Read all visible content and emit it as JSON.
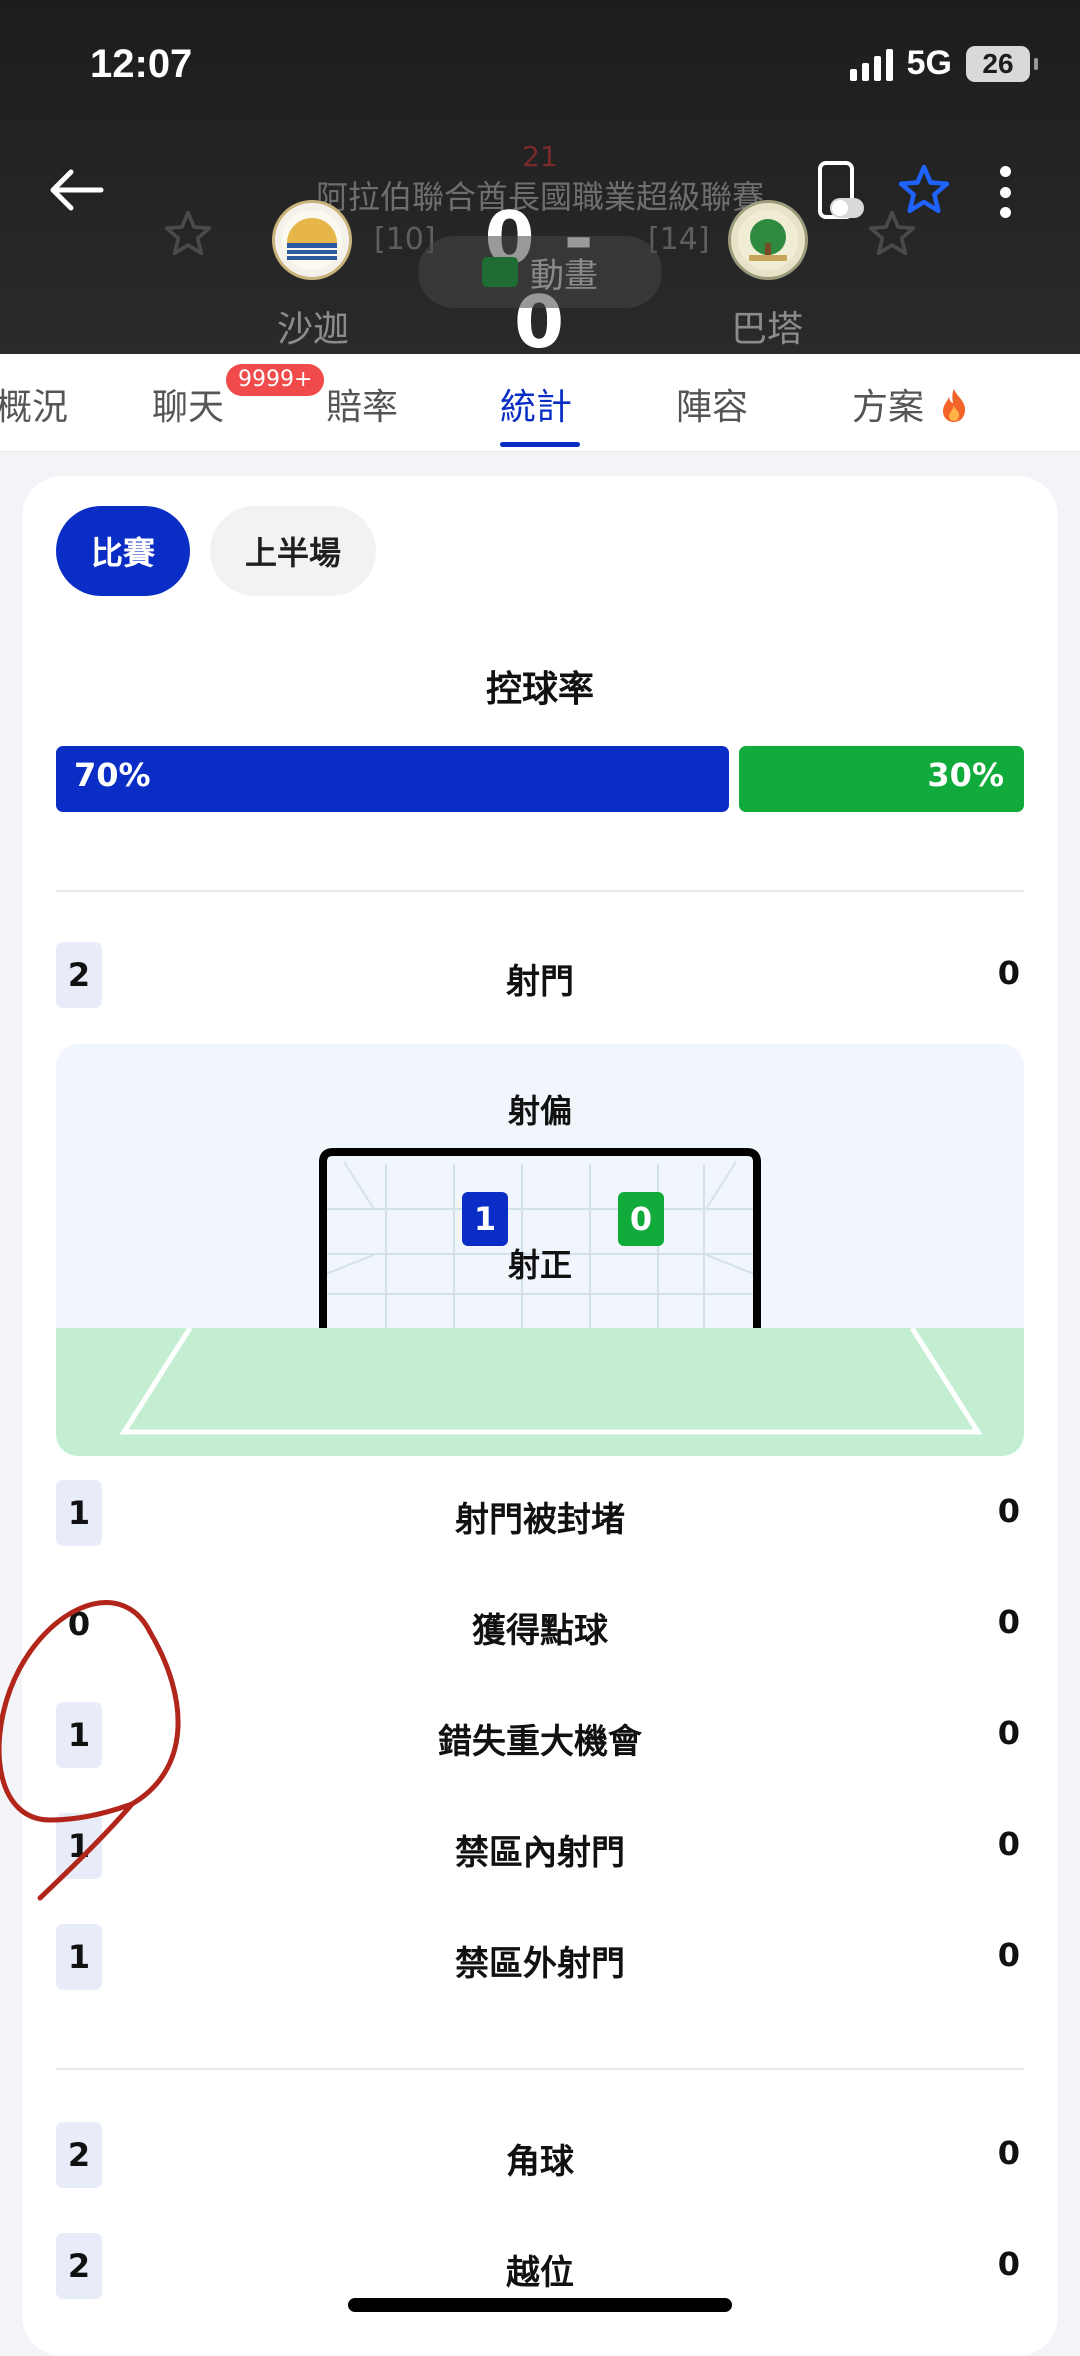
{
  "status_bar": {
    "time": "12:07",
    "network": "5G",
    "battery": "26"
  },
  "header": {
    "minute": "21",
    "league": "阿拉伯聯合酋長國職業超級聯賽",
    "home_team": "沙迦",
    "away_team": "巴塔",
    "home_rank": "[10]",
    "away_rank": "[14]",
    "score": "0 - 0",
    "animation_label": "動畫",
    "icons": [
      "back-arrow-icon",
      "phone-toggle-icon",
      "star-icon",
      "more-vertical-icon"
    ]
  },
  "tabs": [
    {
      "label": "概況",
      "active": false
    },
    {
      "label": "聊天",
      "active": false,
      "badge": "9999+"
    },
    {
      "label": "賠率",
      "active": false
    },
    {
      "label": "統計",
      "active": true
    },
    {
      "label": "陣容",
      "active": false
    },
    {
      "label": "方案",
      "active": false,
      "icon": "fire-icon"
    }
  ],
  "segments": {
    "match": "比賽",
    "first_half": "上半場",
    "selected": "match"
  },
  "possession": {
    "title": "控球率",
    "home": "70%",
    "away": "30%",
    "home_fraction": 0.7
  },
  "shots": {
    "label": "射門",
    "home": "2",
    "away": "0",
    "off_target_label": "射偏",
    "on_target_label": "射正",
    "on_target_home": "1",
    "on_target_away": "0"
  },
  "stats": [
    {
      "label": "射門被封堵",
      "home": "1",
      "away": "0"
    },
    {
      "label": "獲得點球",
      "home": "0",
      "away": "0"
    },
    {
      "label": "錯失重大機會",
      "home": "1",
      "away": "0"
    },
    {
      "label": "禁區內射門",
      "home": "1",
      "away": "0"
    },
    {
      "label": "禁區外射門",
      "home": "1",
      "away": "0"
    }
  ],
  "stats2": [
    {
      "label": "角球",
      "home": "2",
      "away": "0"
    },
    {
      "label": "越位",
      "home": "2",
      "away": "0"
    }
  ],
  "colors": {
    "home": "#0a2ec5",
    "away": "#10ab3a",
    "annotation": "#b1251b"
  }
}
